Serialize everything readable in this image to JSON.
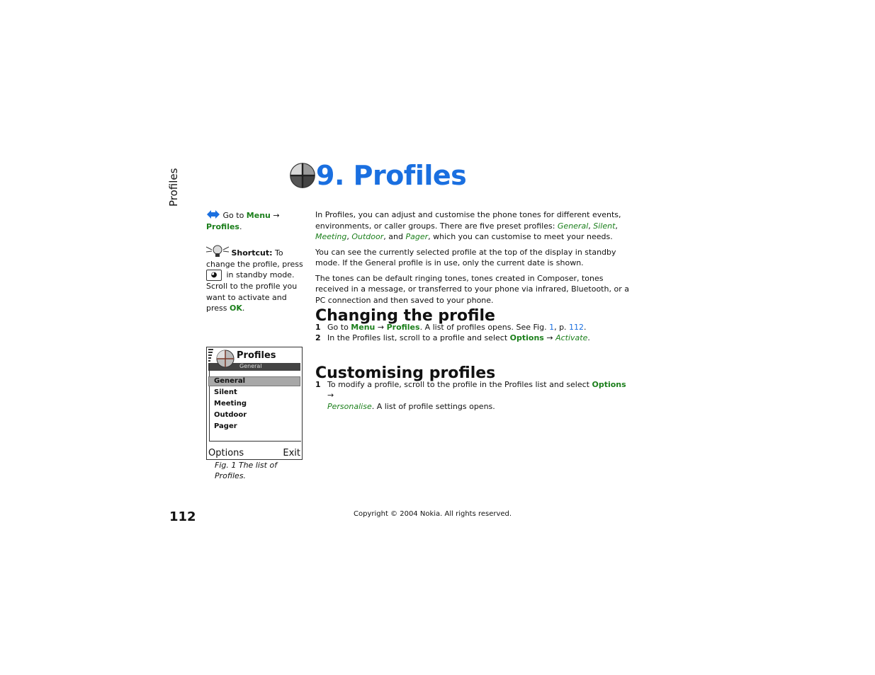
{
  "side_tab": "Profiles",
  "chapter": {
    "title": "9. Profiles",
    "icon": "profiles-icon"
  },
  "sidebar": {
    "goto": {
      "icon": "navigation-arrow-icon",
      "prefix": "Go to ",
      "menu": "Menu",
      "arrow": " → ",
      "profiles": "Profiles",
      "end": "."
    },
    "shortcut": {
      "icon": "lightbulb-tip-icon",
      "label": "Shortcut:",
      "text1": " To change the profile, press ",
      "key_icon": "power-key-icon",
      "text2": " in standby mode. Scroll to the profile you want to activate and press ",
      "ok": "OK",
      "end": "."
    }
  },
  "intro": {
    "p1_a": "In Profiles, you can adjust and customise the phone tones for different events, environments, or caller groups. There are five preset profiles: ",
    "p1_general": "General",
    "p1_sep1": ", ",
    "p1_silent": "Silent",
    "p1_sep2": ", ",
    "p1_meeting": "Meeting",
    "p1_sep3": ", ",
    "p1_outdoor": "Outdoor",
    "p1_sep4": ", and ",
    "p1_pager": "Pager",
    "p1_end": ", which you can customise to meet your needs.",
    "p2": "You can see the currently selected profile at the top of the display in standby mode. If the General profile is in use, only the current date is shown.",
    "p3": "The tones can be default ringing tones, tones created in Composer, tones received in a message, or transferred to your phone via infrared, Bluetooth, or a PC connection and then saved to your phone."
  },
  "changing": {
    "heading": "Changing the profile",
    "step1": {
      "num": "1",
      "a": "Go to ",
      "menu": "Menu",
      "arrow": " → ",
      "profiles": "Profiles",
      "b": ". A list of profiles opens. See Fig. ",
      "fig": "1",
      "c": ", p. ",
      "page": "112",
      "d": "."
    },
    "step2": {
      "num": "2",
      "a": "In the Profiles list, scroll to a profile and select ",
      "options": "Options",
      "arrow": " → ",
      "activate": "Activate",
      "d": "."
    }
  },
  "customising": {
    "heading": "Customising profiles",
    "step1": {
      "num": "1",
      "a": "To modify a profile, scroll to the profile in the Profiles list and select ",
      "options": "Options",
      "arrow": " → ",
      "personalise": "Personalise",
      "b": ". A list of profile settings opens."
    }
  },
  "phone_screen": {
    "title": "Profiles",
    "current": "General",
    "items": [
      "General",
      "Silent",
      "Meeting",
      "Outdoor",
      "Pager"
    ],
    "selected_index": 0,
    "left_softkey": "Options",
    "right_softkey": "Exit"
  },
  "figure_caption": "Fig. 1 The list of Profiles.",
  "footer": {
    "page_number": "112",
    "copyright": "Copyright © 2004 Nokia. All rights reserved."
  },
  "colors": {
    "heading_blue": "#1a6fe0",
    "link_green": "#1b7f1b"
  }
}
